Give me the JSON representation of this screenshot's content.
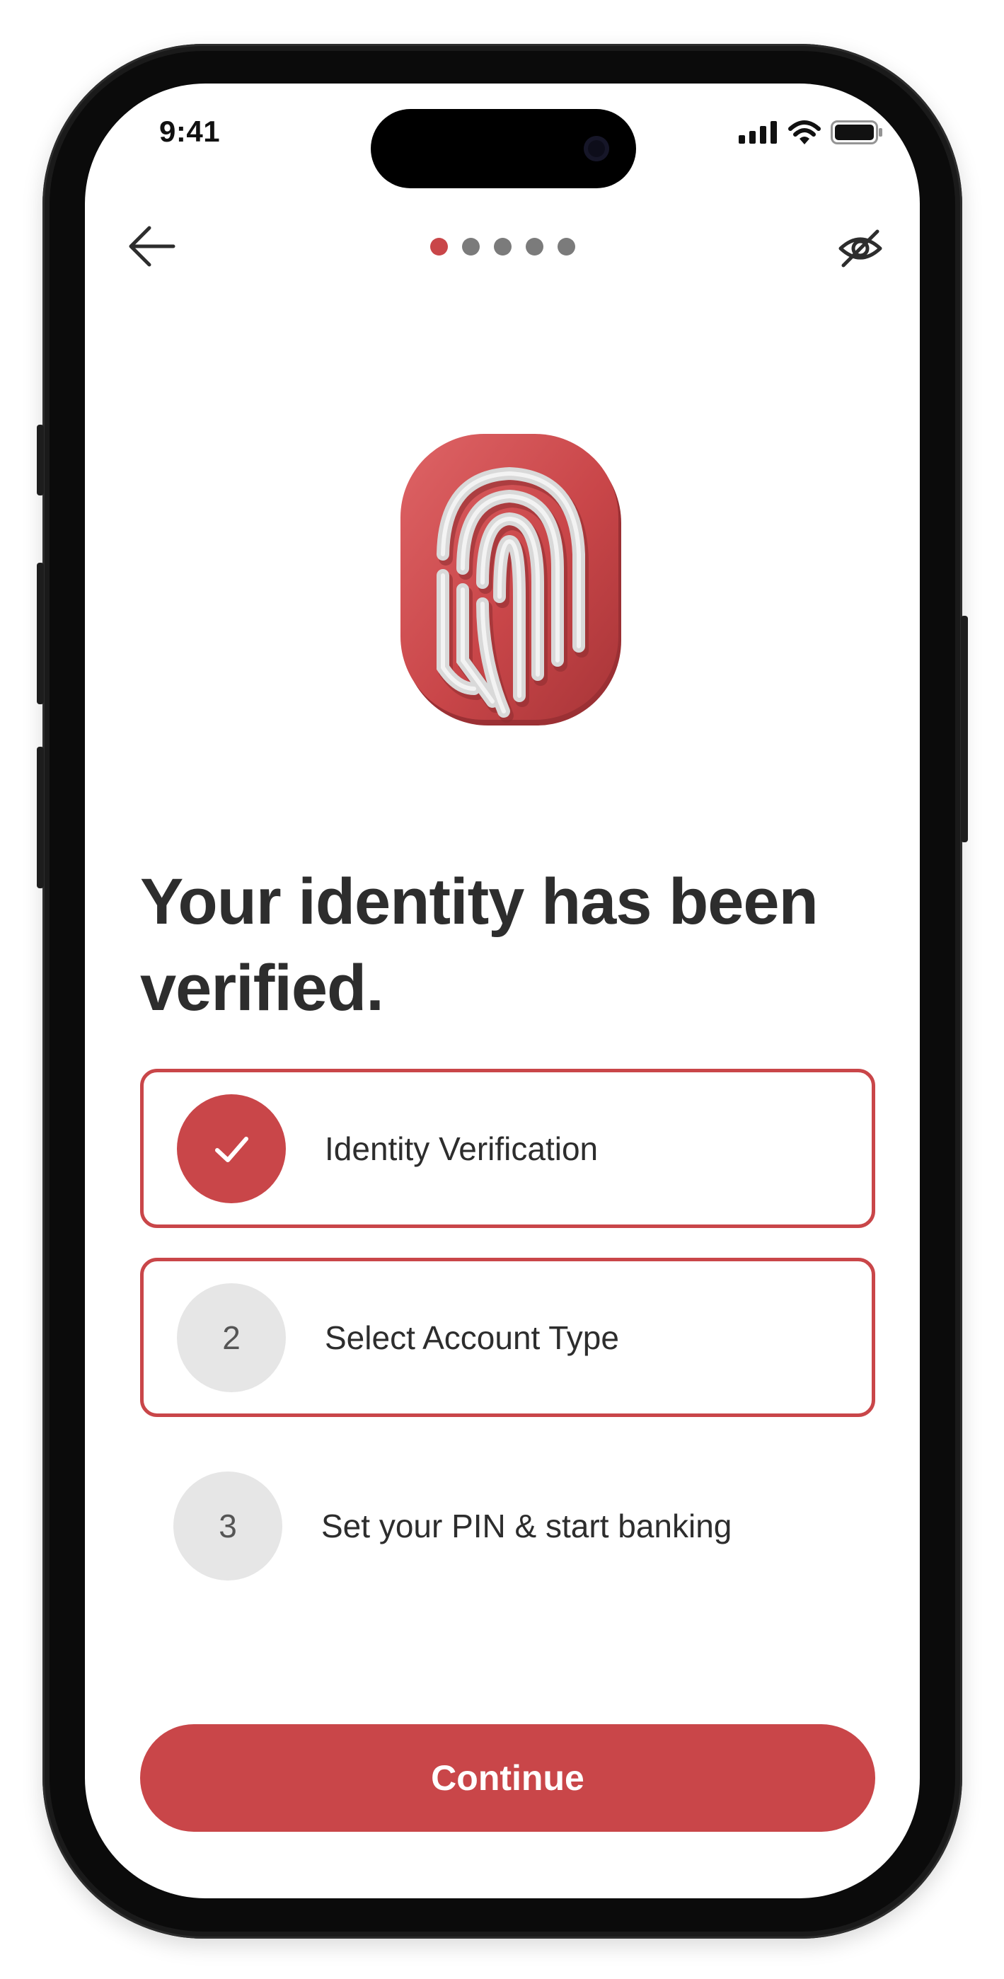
{
  "status_bar": {
    "time": "9:41",
    "icons": [
      "cellular-signal-icon",
      "wifi-icon",
      "battery-icon"
    ]
  },
  "nav": {
    "back_icon": "arrow-left-icon",
    "visibility_icon": "eye-off-icon",
    "progress": {
      "total_steps": 5,
      "current_step": 1
    }
  },
  "hero": {
    "icon": "fingerprint-icon"
  },
  "headline": "Your identity has been verified.",
  "steps": [
    {
      "badge": "",
      "status": "completed",
      "icon": "checkmark-icon",
      "label": "Identity Verification"
    },
    {
      "badge": "2",
      "status": "current",
      "label": "Select Account Type"
    },
    {
      "badge": "3",
      "status": "upcoming",
      "label": "Set your PIN & start banking"
    }
  ],
  "continue_button": {
    "label": "Continue"
  },
  "colors": {
    "accent": "#c94649",
    "text": "#2d2d2d",
    "badge_pending": "#e6e6e6",
    "dot_inactive": "#7b7b7b"
  }
}
